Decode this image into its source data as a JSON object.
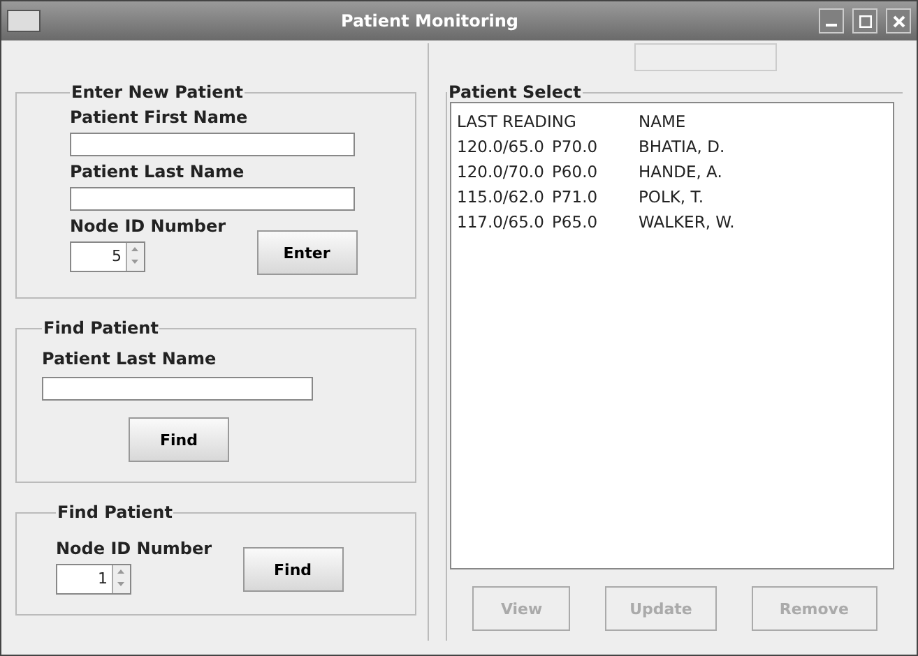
{
  "window": {
    "title": "Patient Monitoring"
  },
  "enter_patient": {
    "title": "Enter New Patient",
    "first_name_label": "Patient First Name",
    "last_name_label": "Patient Last Name",
    "node_label": "Node ID Number",
    "node_value": "5",
    "button": "Enter"
  },
  "find_by_name": {
    "title": "Find Patient",
    "label": "Patient Last Name",
    "button": "Find"
  },
  "find_by_node": {
    "title": "Find Patient",
    "label": "Node ID Number",
    "node_value": "1",
    "button": "Find"
  },
  "patient_select": {
    "title": "Patient Select",
    "header": {
      "reading": "LAST READING",
      "name": "NAME"
    },
    "rows": [
      {
        "reading": "120.0/65.0",
        "pulse": "P70.0",
        "name": "BHATIA, D."
      },
      {
        "reading": "120.0/70.0",
        "pulse": "P60.0",
        "name": "HANDE, A."
      },
      {
        "reading": "115.0/62.0",
        "pulse": "P71.0",
        "name": "POLK, T."
      },
      {
        "reading": "117.0/65.0",
        "pulse": "P65.0",
        "name": "WALKER, W."
      }
    ],
    "buttons": [
      {
        "label": "View",
        "disabled": true
      },
      {
        "label": "Update",
        "disabled": true
      },
      {
        "label": "Remove",
        "disabled": true
      }
    ]
  }
}
